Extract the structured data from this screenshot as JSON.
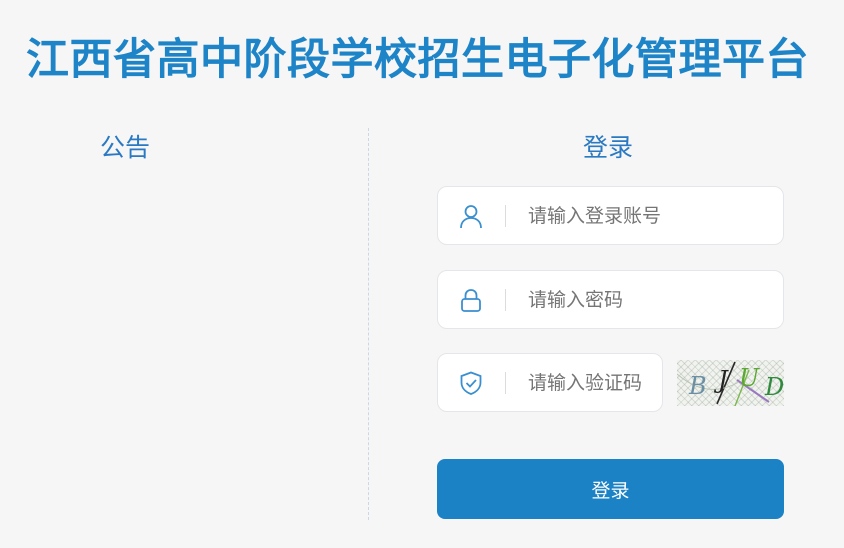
{
  "page": {
    "title": "江西省高中阶段学校招生电子化管理平台"
  },
  "notice": {
    "title": "公告"
  },
  "login": {
    "title": "登录",
    "account_placeholder": "请输入登录账号",
    "password_placeholder": "请输入密码",
    "captcha_placeholder": "请输入验证码",
    "captcha_chars": [
      "B",
      "J",
      "U",
      "D"
    ],
    "submit_label": "登录"
  },
  "icons": {
    "account": "user-icon",
    "password": "lock-icon",
    "captcha": "shield-check-icon"
  },
  "colors": {
    "brand": "#1e84c8",
    "heading": "#2a79c2",
    "button": "#1c82c6",
    "icon": "#3a8fd0"
  }
}
